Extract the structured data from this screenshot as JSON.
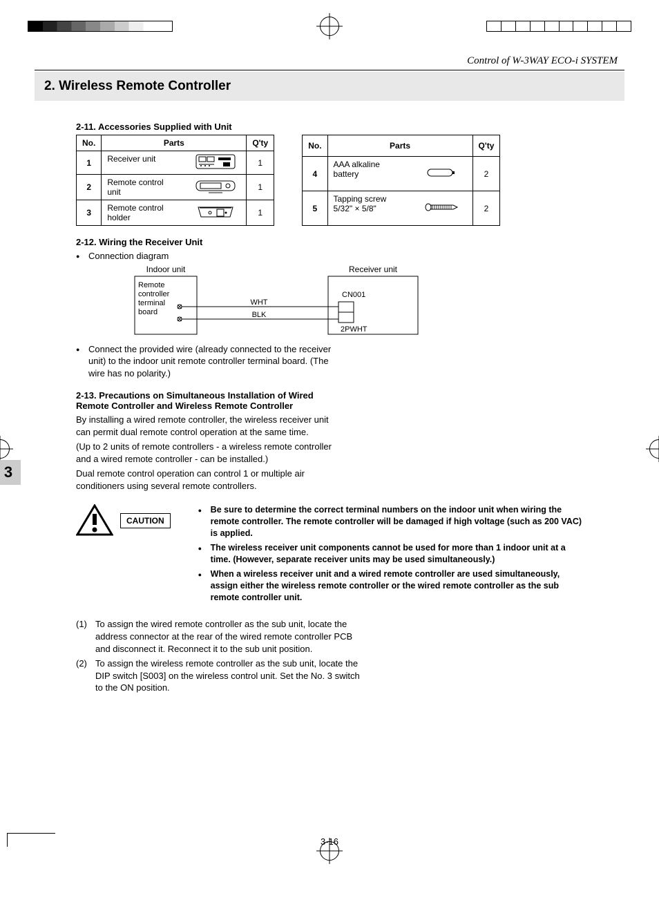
{
  "header": {
    "running_title": "Control of W-3WAY ECO-i SYSTEM",
    "section_title": "2. Wireless Remote Controller",
    "chapter_tab": "3",
    "page_number": "3-16"
  },
  "accessories": {
    "heading": "2-11. Accessories Supplied with Unit",
    "columns": {
      "no": "No.",
      "parts": "Parts",
      "qty": "Q'ty"
    },
    "left": [
      {
        "no": "1",
        "name": "Receiver unit",
        "qty": "1"
      },
      {
        "no": "2",
        "name": "Remote control unit",
        "qty": "1"
      },
      {
        "no": "3",
        "name": "Remote control holder",
        "qty": "1"
      }
    ],
    "right": [
      {
        "no": "4",
        "name": "AAA alkaline battery",
        "qty": "2"
      },
      {
        "no": "5",
        "name": "Tapping screw 5/32\"  ×  5/8\"",
        "qty": "2"
      }
    ]
  },
  "wiring": {
    "heading": "2-12. Wiring the Receiver Unit",
    "bullet_label": "Connection diagram",
    "diagram": {
      "left_box_title": "Indoor unit",
      "left_inner": "Remote controller terminal board",
      "wire_top": "WHT",
      "wire_bottom": "BLK",
      "right_box_title": "Receiver unit",
      "right_upper_label": "CN001",
      "right_lower_label": "2PWHT"
    },
    "after_bullet": "Connect the provided wire (already connected to the receiver unit) to the indoor unit remote controller terminal board. (The wire has no polarity.)"
  },
  "precautions": {
    "heading": "2-13. Precautions on Simultaneous Installation of Wired Remote Controller and Wireless Remote Controller",
    "para1": "By installing a wired remote controller, the wireless receiver unit can permit dual remote control operation at the same time.",
    "para2": "(Up to 2 units of remote controllers - a wireless remote controller and a wired remote controller - can be installed.)",
    "para3": "Dual remote control operation can control 1 or multiple air conditioners using several remote controllers."
  },
  "caution": {
    "label": "CAUTION",
    "items": [
      "Be sure to determine the correct terminal numbers on the indoor unit when wiring the remote controller. The remote controller will be damaged if high voltage (such as 200 VAC) is applied.",
      "The wireless receiver unit components cannot be used for more than 1 indoor unit at a time. (However, separate receiver units may be used simultaneously.)",
      "When a wireless receiver unit and a wired remote controller are used simultaneously, assign either the wireless remote controller or the wired remote controller as the sub remote controller unit."
    ]
  },
  "steps": [
    {
      "num": "(1)",
      "text": "To assign the wired remote controller as the sub unit, locate the address connector at the rear of the wired remote controller PCB and disconnect it. Reconnect it to the sub unit position."
    },
    {
      "num": "(2)",
      "text": "To assign the wireless remote controller as the sub unit, locate the DIP switch [S003] on the wireless control unit. Set the No. 3 switch to the ON position."
    }
  ]
}
